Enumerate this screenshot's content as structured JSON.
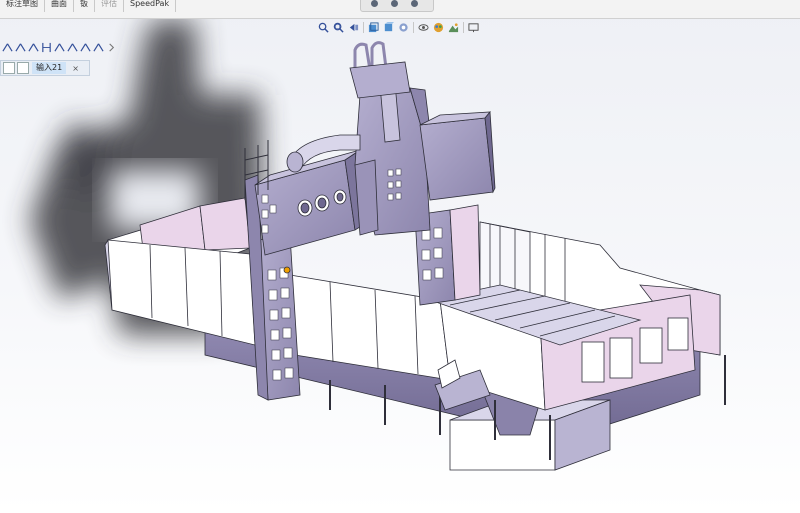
{
  "command_tabs": [
    {
      "label": "标注草图",
      "muted": false
    },
    {
      "label": "曲面",
      "muted": false
    },
    {
      "label": "钣",
      "muted": false
    },
    {
      "label": "评估",
      "muted": true
    },
    {
      "label": "SpeedPak",
      "muted": false
    }
  ],
  "view_toolbar": {
    "icons": [
      "zoom-to-fit-icon",
      "zoom-area-icon",
      "previous-view-icon",
      "section-view-icon",
      "view-orientation-icon",
      "display-style-icon",
      "hide-show-icon",
      "appearance-icon",
      "scene-icon",
      "display-pane-icon"
    ]
  },
  "sketch_toolbar": {
    "icons": [
      "sketch-line-icon",
      "sketch-line-icon",
      "sketch-line-icon",
      "sketch-dimension-icon",
      "sketch-line-icon",
      "sketch-line-icon",
      "sketch-line-icon",
      "sketch-line-icon"
    ]
  },
  "input_tab": {
    "label": "输入21",
    "close": "×"
  },
  "colors": {
    "machine_lavender": "#9a93b8",
    "machine_light": "#b9b4d2",
    "guard_white": "#ffffff",
    "guard_pink": "#ead5ea",
    "outline": "#2f2f3a",
    "accent_orange": "#f0a000"
  }
}
